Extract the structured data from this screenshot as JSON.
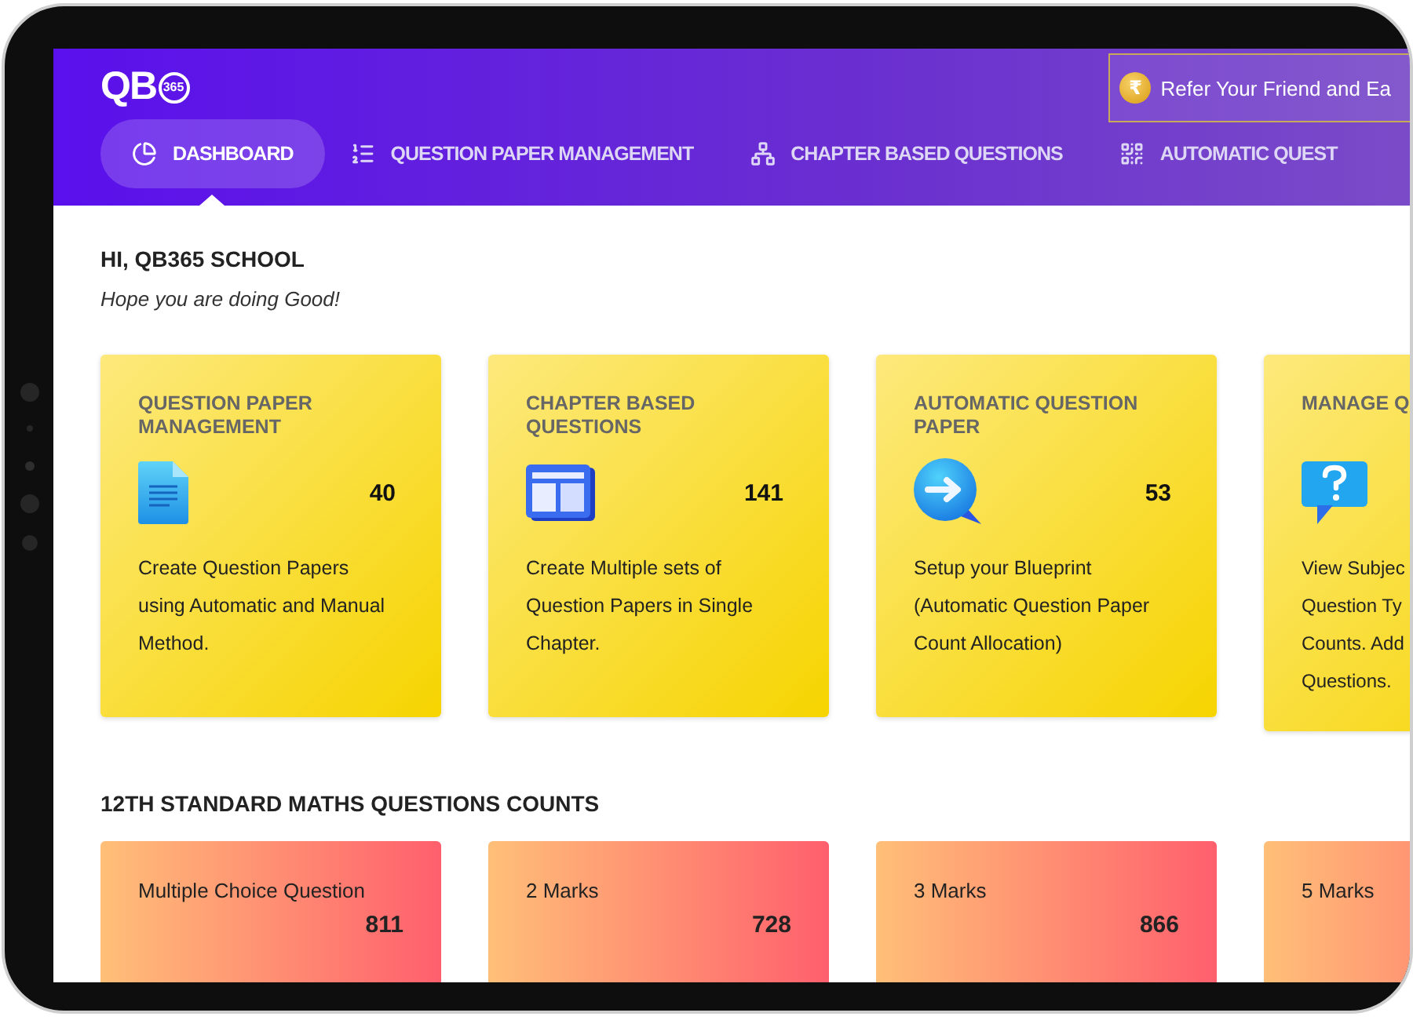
{
  "header": {
    "logo": {
      "text": "QB",
      "badge": "365"
    },
    "referral": {
      "coin_symbol": "₹",
      "label": "Refer Your Friend and Ea"
    },
    "nav": [
      {
        "label": "DASHBOARD",
        "selected": true
      },
      {
        "label": "QUESTION PAPER MANAGEMENT",
        "selected": false
      },
      {
        "label": "CHAPTER BASED QUESTIONS",
        "selected": false
      },
      {
        "label": "AUTOMATIC QUEST",
        "selected": false
      }
    ]
  },
  "greeting": {
    "title": "HI, QB365 SCHOOL",
    "subtitle": "Hope you are doing Good!"
  },
  "feature_cards": [
    {
      "title": "QUESTION PAPER MANAGEMENT",
      "count": "40",
      "description": "Create Question Papers using Automatic and Manual Method."
    },
    {
      "title": "CHAPTER BASED QUESTIONS",
      "count": "141",
      "description": "Create Multiple sets of Question Papers in Single Chapter."
    },
    {
      "title": "AUTOMATIC QUESTION PAPER",
      "count": "53",
      "description": "Setup your Blueprint (Automatic Question Paper Count Allocation)"
    },
    {
      "title": "MANAGE Q",
      "lines": [
        "View Subjec",
        "Question Ty",
        "Counts. Add",
        "Questions."
      ]
    }
  ],
  "counts_section": {
    "title": "12TH STANDARD MATHS QUESTIONS COUNTS",
    "cards": [
      {
        "label": "Multiple Choice Question",
        "count": "811"
      },
      {
        "label": "2 Marks",
        "count": "728"
      },
      {
        "label": "3 Marks",
        "count": "866"
      },
      {
        "label": "5 Marks"
      }
    ]
  }
}
